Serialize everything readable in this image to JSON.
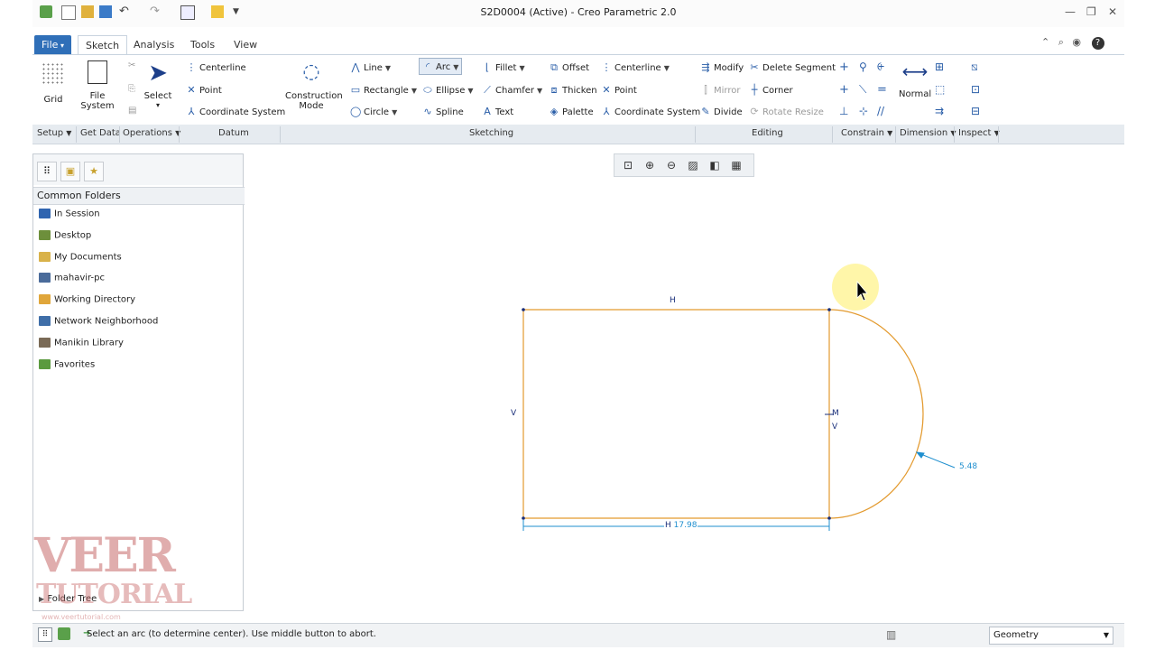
{
  "window": {
    "title": "S2D0004 (Active) - Creo Parametric 2.0"
  },
  "tabs": [
    {
      "label": "File"
    },
    {
      "label": "Sketch"
    },
    {
      "label": "Analysis"
    },
    {
      "label": "Tools"
    },
    {
      "label": "View"
    }
  ],
  "ribbon": {
    "grid": "Grid",
    "file_system_1": "File",
    "file_system_2": "System",
    "select": "Select",
    "datum": {
      "centerline": "Centerline",
      "point": "Point",
      "coord": "Coordinate System"
    },
    "construction_1": "Construction",
    "construction_2": "Mode",
    "sketching": {
      "line": "Line",
      "arc": "Arc",
      "fillet": "Fillet",
      "offset": "Offset",
      "centerline": "Centerline",
      "rectangle": "Rectangle",
      "ellipse": "Ellipse",
      "chamfer": "Chamfer",
      "thicken": "Thicken",
      "point": "Point",
      "circle": "Circle",
      "spline": "Spline",
      "text": "Text",
      "palette": "Palette",
      "coord": "Coordinate System"
    },
    "editing": {
      "modify": "Modify",
      "delete_segment": "Delete Segment",
      "mirror": "Mirror",
      "corner": "Corner",
      "divide": "Divide",
      "rotate_resize": "Rotate Resize"
    },
    "normal": "Normal"
  },
  "groups": {
    "setup": "Setup",
    "get_data": "Get Data",
    "operations": "Operations",
    "datum": "Datum",
    "sketching": "Sketching",
    "editing": "Editing",
    "constrain": "Constrain",
    "dimension": "Dimension",
    "inspect": "Inspect"
  },
  "navigator": {
    "header": "Common Folders",
    "folders": [
      {
        "label": "In Session",
        "color": "#2f64b0"
      },
      {
        "label": "Desktop",
        "color": "#6d8f3b"
      },
      {
        "label": "My Documents",
        "color": "#d9b24a"
      },
      {
        "label": "mahavir-pc",
        "color": "#4a6b9a"
      },
      {
        "label": "Working Directory",
        "color": "#e0a63a"
      },
      {
        "label": "Network Neighborhood",
        "color": "#3f6ea8"
      },
      {
        "label": "Manikin Library",
        "color": "#7a6a56"
      },
      {
        "label": "Favorites",
        "color": "#5b9a3f"
      }
    ],
    "folder_tree": "Folder Tree"
  },
  "watermark": {
    "line1": "VEER",
    "line2": "TUTORIAL",
    "line3": "www.veertutorial.com"
  },
  "sketch": {
    "constraint_h": "H",
    "constraint_v_left": "V",
    "constraint_m": "M",
    "constraint_v_right": "V",
    "dim_width": "17.98",
    "dim_radius": "5.48"
  },
  "status": {
    "message": "Select an arc (to determine center). Use middle button to abort.",
    "filter": "Geometry"
  },
  "colors": {
    "sketch_geometry": "#e39a2e",
    "dimension": "#1f8fcf",
    "constraint": "#1a2f7a",
    "file_tab": "#2f6fb8"
  }
}
